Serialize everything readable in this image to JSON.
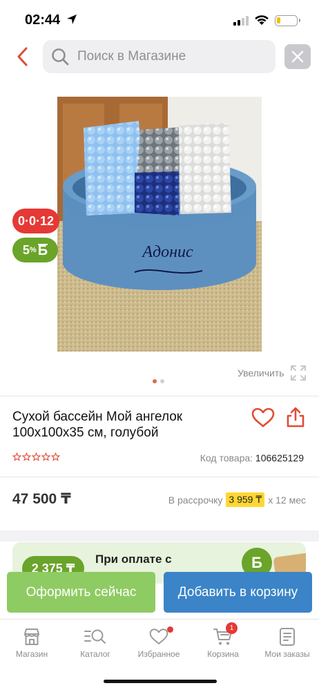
{
  "status_bar": {
    "time": "02:44"
  },
  "search": {
    "placeholder": "Поиск в Магазине"
  },
  "badges": {
    "installment": "0·0·12",
    "bonus_percent": "5",
    "bonus_sign": "%",
    "bonus_letter": "Б"
  },
  "image_text": "Адонис",
  "gallery": {
    "zoom_label": "Увеличить",
    "dots": 2,
    "active_dot": 1
  },
  "product": {
    "title": "Сухой бассейн Мой ангелок 100х100х35 см, голубой",
    "code_label": "Код товара:",
    "code_value": "106625129",
    "rating_stars": 0,
    "rating_max": 5,
    "price": "47 500 ₸",
    "installment_prefix": "В рассрочку",
    "installment_amount": "3 959 ₸",
    "installment_suffix": "х 12 мес"
  },
  "promo": {
    "amount": "2 375 ₸",
    "text": "При оплате с",
    "icon_letter": "Б"
  },
  "actions": {
    "order_label": "Оформить сейчас",
    "cart_label": "Добавить в корзину"
  },
  "tabbar": {
    "items": [
      {
        "label": "Магазин",
        "icon": "shop-icon"
      },
      {
        "label": "Каталог",
        "icon": "catalog-search-icon"
      },
      {
        "label": "Избранное",
        "icon": "heart-icon"
      },
      {
        "label": "Корзина",
        "icon": "cart-icon",
        "badge": "1"
      },
      {
        "label": "Мои заказы",
        "icon": "orders-icon"
      }
    ]
  },
  "colors": {
    "accent_red": "#e53935",
    "green": "#8fcb63",
    "blue": "#3b84c8",
    "installment_highlight": "#ffd731"
  }
}
